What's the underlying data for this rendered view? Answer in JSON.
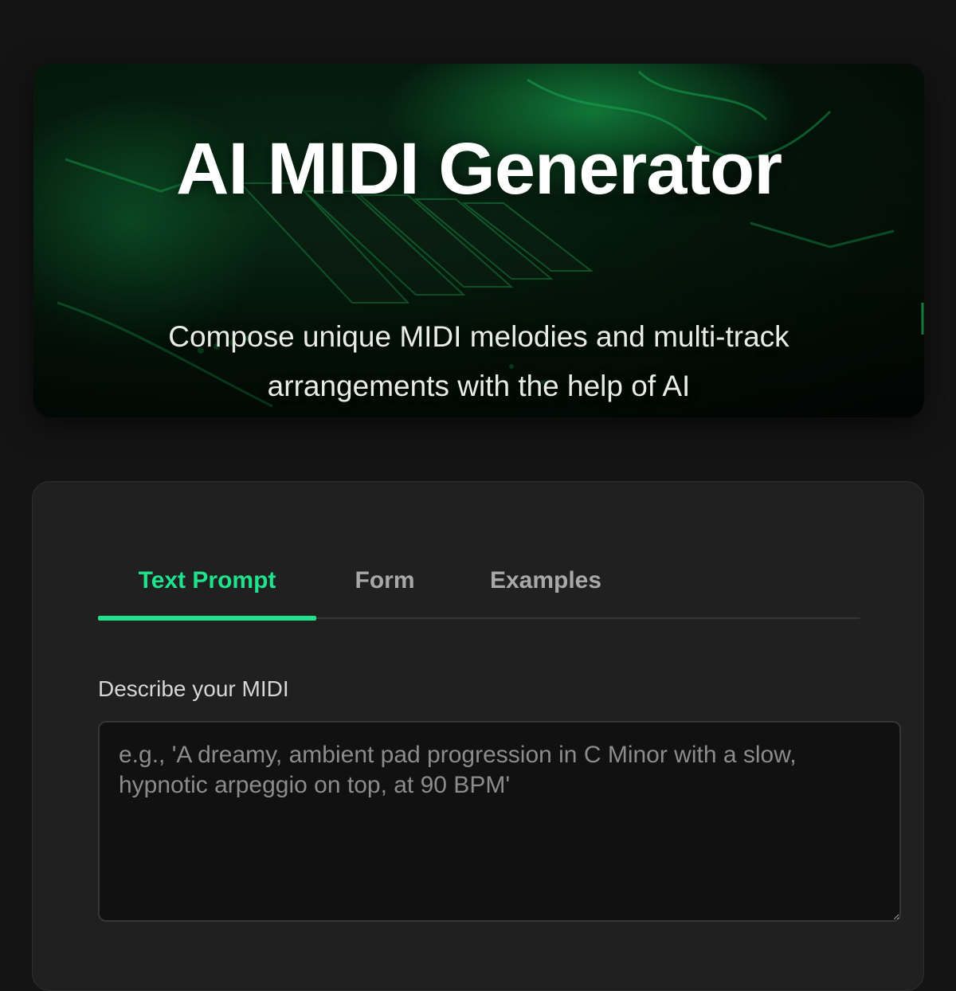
{
  "hero": {
    "title": "AI MIDI Generator",
    "subtitle": "Compose unique MIDI melodies and multi-track arrangements with the help of AI",
    "accent_color": "#1fe28c"
  },
  "tabs": [
    {
      "label": "Text Prompt",
      "active": true
    },
    {
      "label": "Form",
      "active": false
    },
    {
      "label": "Examples",
      "active": false
    }
  ],
  "prompt": {
    "label": "Describe your MIDI",
    "value": "",
    "placeholder": "e.g., 'A dreamy, ambient pad progression in C Minor with a slow, hypnotic arpeggio on top, at 90 BPM'"
  }
}
